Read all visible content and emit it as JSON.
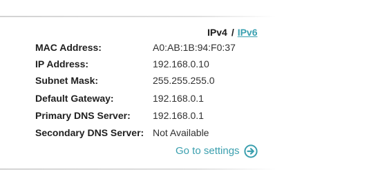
{
  "ip_toggle": {
    "active": "IPv4",
    "separator": "/",
    "alternate": "IPv6"
  },
  "network_info": [
    {
      "label": "MAC Address:",
      "value": "A0:AB:1B:94:F0:37"
    },
    {
      "label": "IP Address:",
      "value": "192.168.0.10"
    },
    {
      "label": "Subnet Mask:",
      "value": "255.255.255.0"
    },
    {
      "label": "Default Gateway:",
      "value": "192.168.0.1"
    },
    {
      "label": "Primary DNS Server:",
      "value": "192.168.0.1"
    },
    {
      "label": "Secondary DNS Server:",
      "value": "Not Available"
    }
  ],
  "settings_link": {
    "label": "Go to settings",
    "icon": "circle-arrow-right-icon"
  },
  "colors": {
    "accent": "#3a9fae",
    "label_text": "#1f1f1f",
    "value_text": "#303030"
  }
}
